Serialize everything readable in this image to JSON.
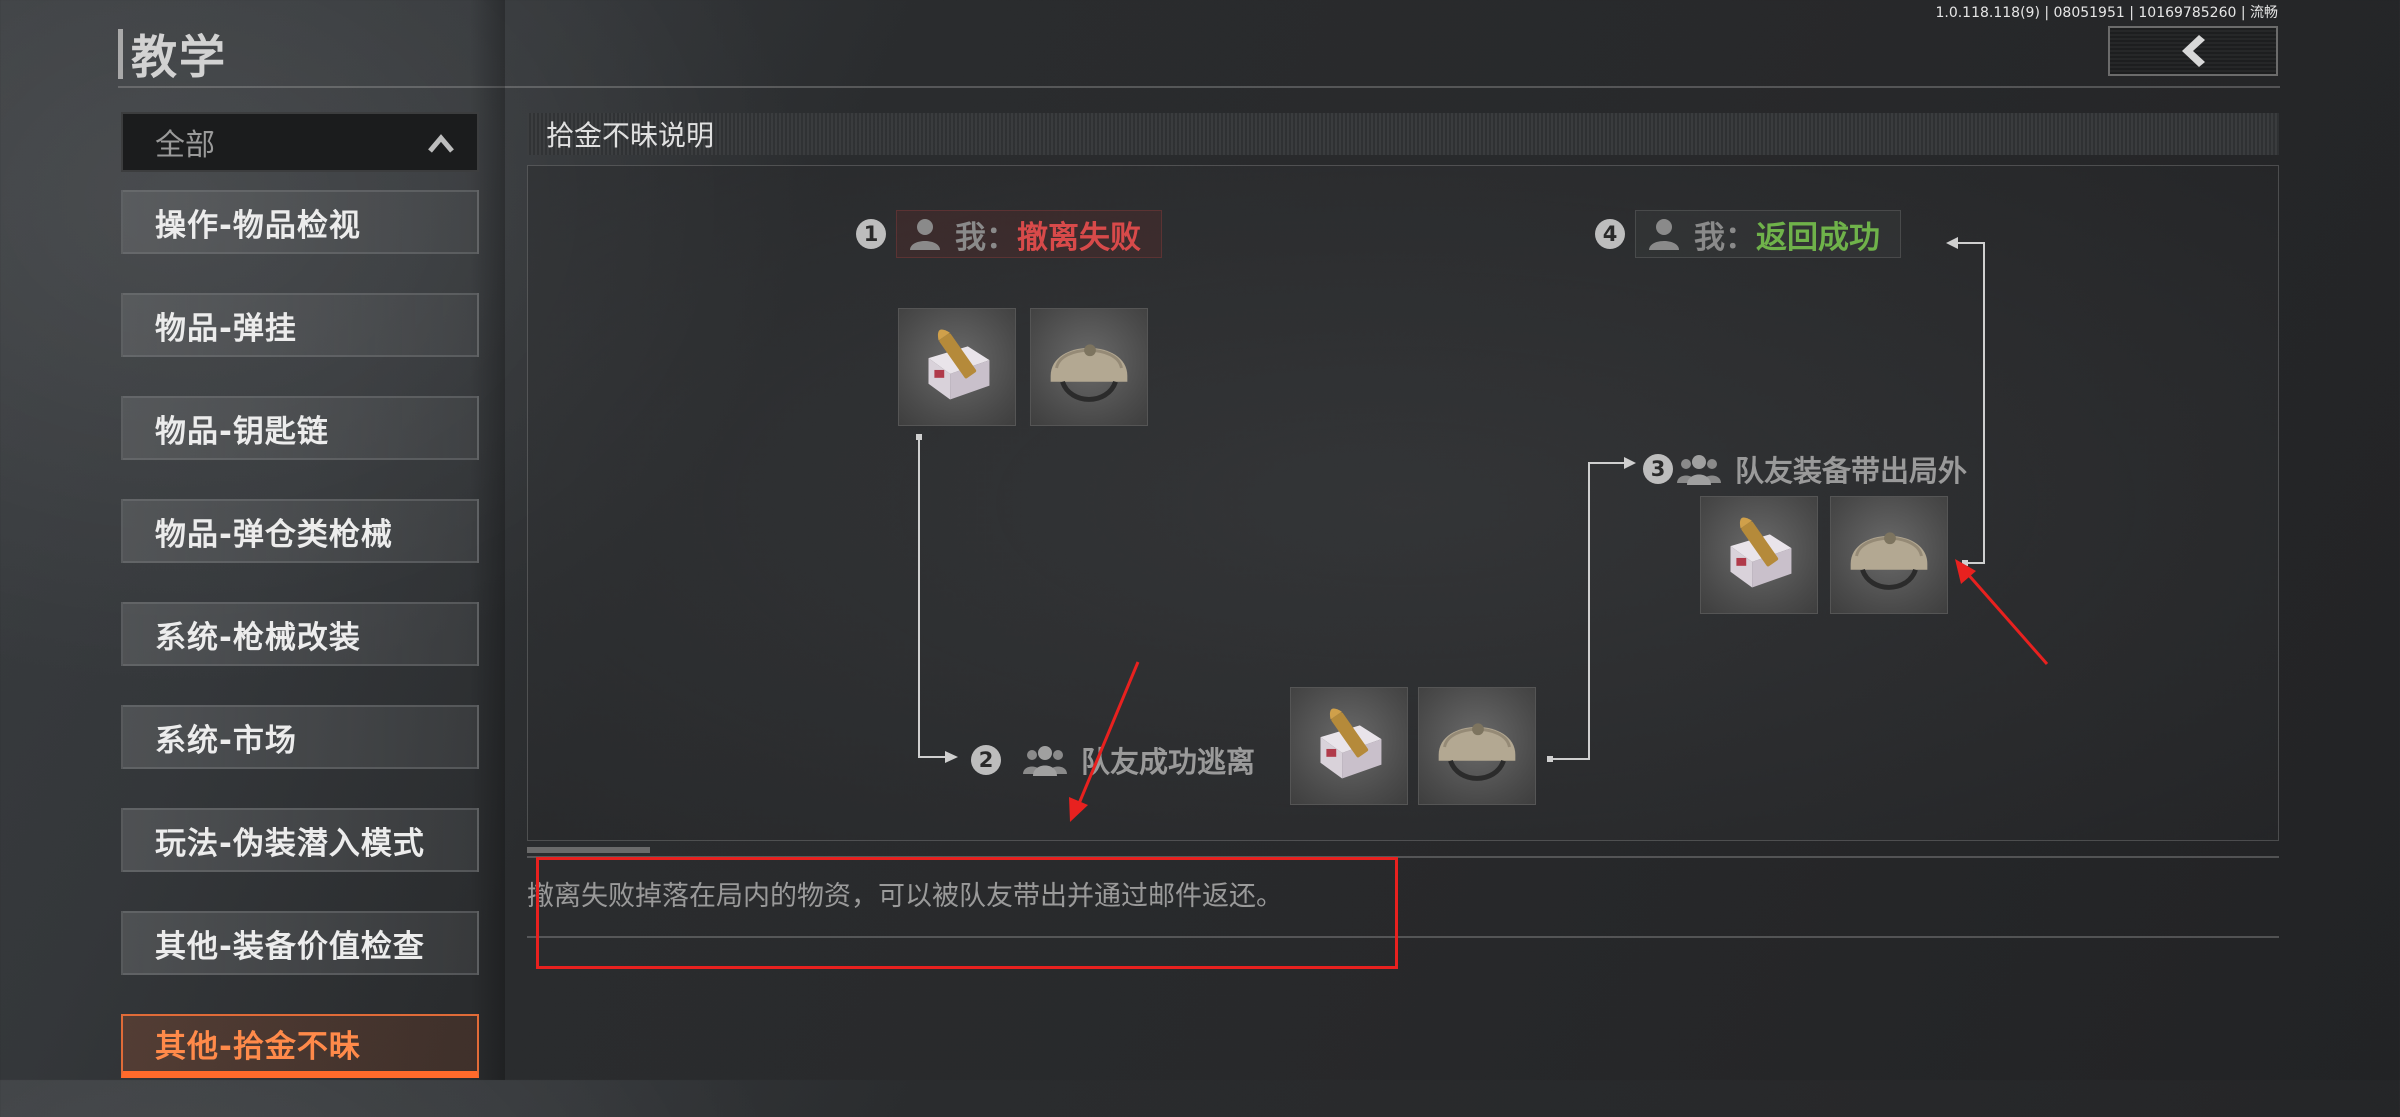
{
  "version": "1.0.118.118(9) | 08051951 | 10169785260 | 流畅",
  "page_title": "教学",
  "back_button": {
    "icon": "chevron-left-icon"
  },
  "category_dropdown": {
    "selected": "全部",
    "icon": "chevron-up-icon"
  },
  "menu": [
    {
      "label": "操作-物品检视",
      "active": false
    },
    {
      "label": "物品-弹挂",
      "active": false
    },
    {
      "label": "物品-钥匙链",
      "active": false
    },
    {
      "label": "物品-弹仓类枪械",
      "active": false
    },
    {
      "label": "系统-枪械改装",
      "active": false
    },
    {
      "label": "系统-市场",
      "active": false
    },
    {
      "label": "玩法-伪装潜入模式",
      "active": false
    },
    {
      "label": "其他-装备价值检查",
      "active": false
    },
    {
      "label": "其他-拾金不昧",
      "active": true
    }
  ],
  "section_title": "拾金不昧说明",
  "diagram": {
    "step1": {
      "number": "1",
      "me": "我：",
      "status": "撤离失败"
    },
    "step2": {
      "number": "2",
      "label": "队友成功逃离"
    },
    "step3": {
      "number": "3",
      "label": "队友装备带出局外"
    },
    "step4": {
      "number": "4",
      "me": "我：",
      "status": "返回成功"
    },
    "items": [
      "ammo-box-icon",
      "helmet-icon"
    ]
  },
  "description": "撤离失败掉落在局内的物资，可以被队友带出并通过邮件返还。",
  "colors": {
    "accent_orange": "#ff6a2b",
    "fail_red": "#d84a4a",
    "success_green": "#6fb24a",
    "annotation_red": "#e8211f"
  }
}
